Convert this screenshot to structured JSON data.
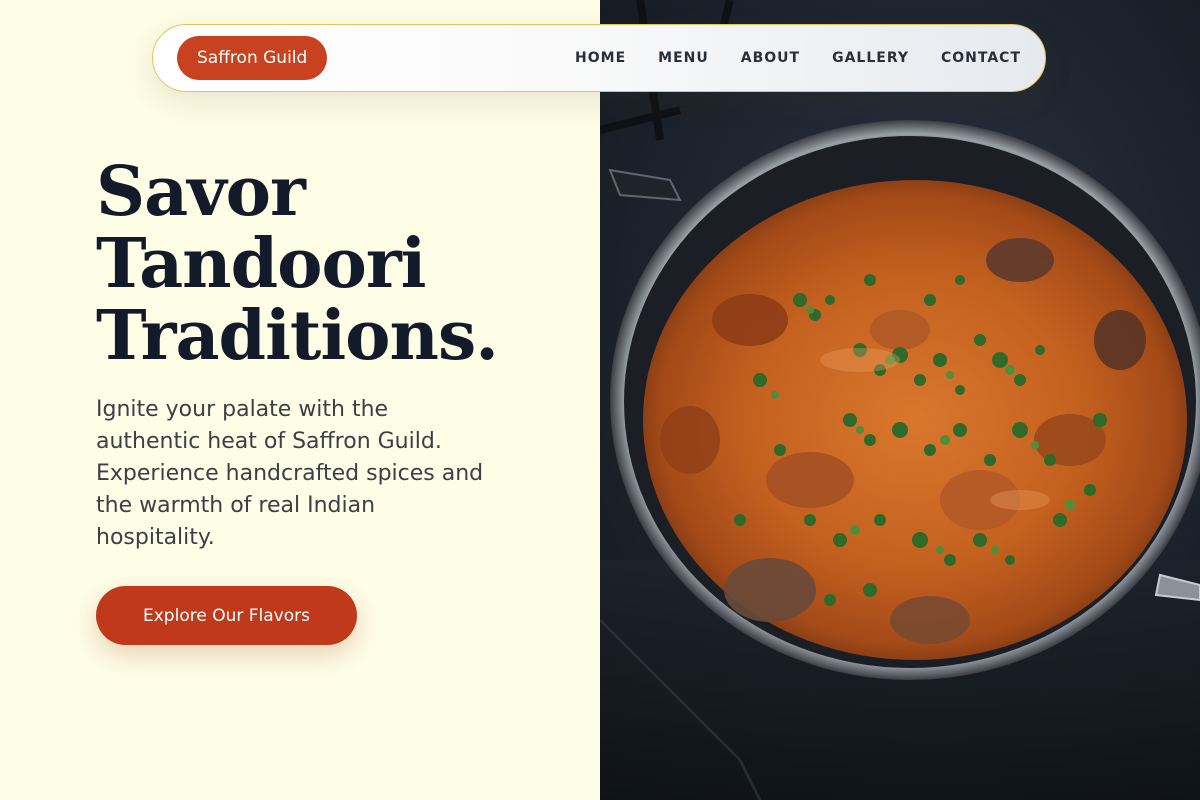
{
  "brand": {
    "name": "Saffron Guild",
    "color": "#c8421f"
  },
  "nav": {
    "items": [
      {
        "label": "HOME"
      },
      {
        "label": "MENU"
      },
      {
        "label": "ABOUT"
      },
      {
        "label": "GALLERY"
      },
      {
        "label": "CONTACT"
      }
    ]
  },
  "hero": {
    "title_lines": [
      "Savor",
      "Tandoori",
      "Traditions."
    ],
    "description": "Ignite your palate with the authentic heat of Saffron Guild. Experience handcrafted spices and the warmth of real Indian hospitality.",
    "cta_label": "Explore Our Flavors",
    "cta_color": "#c0391a",
    "background_color": "#fefde6",
    "image": {
      "subject": "curry-pan-with-cilantro"
    }
  }
}
